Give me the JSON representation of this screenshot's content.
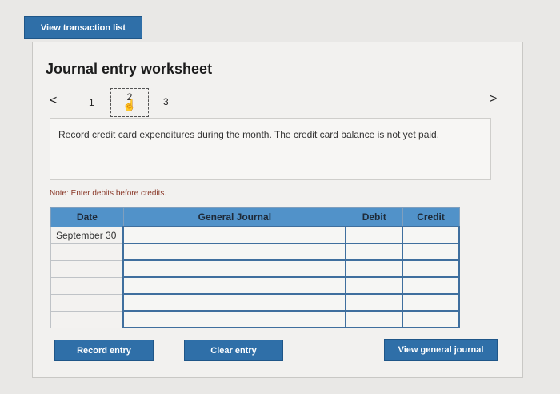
{
  "top": {
    "view_list_label": "View transaction list"
  },
  "worksheet": {
    "title": "Journal entry worksheet",
    "nav": {
      "prev": "<",
      "next": ">",
      "pages": [
        "1",
        "2",
        "3"
      ]
    },
    "description": "Record credit card expenditures during the month. The credit card balance is not yet paid.",
    "note": "Note: Enter debits before credits."
  },
  "table": {
    "headers": [
      "Date",
      "General Journal",
      "Debit",
      "Credit"
    ],
    "rows": [
      [
        "September 30",
        "",
        "",
        ""
      ],
      [
        "",
        "",
        "",
        ""
      ],
      [
        "",
        "",
        "",
        ""
      ],
      [
        "",
        "",
        "",
        ""
      ],
      [
        "",
        "",
        "",
        ""
      ],
      [
        "",
        "",
        "",
        ""
      ]
    ]
  },
  "actions": {
    "record": "Record entry",
    "clear": "Clear entry",
    "view_gj": "View general journal"
  },
  "colors": {
    "button": "#2f6fa8",
    "header": "#5192c9",
    "note": "#8a3a2a"
  }
}
